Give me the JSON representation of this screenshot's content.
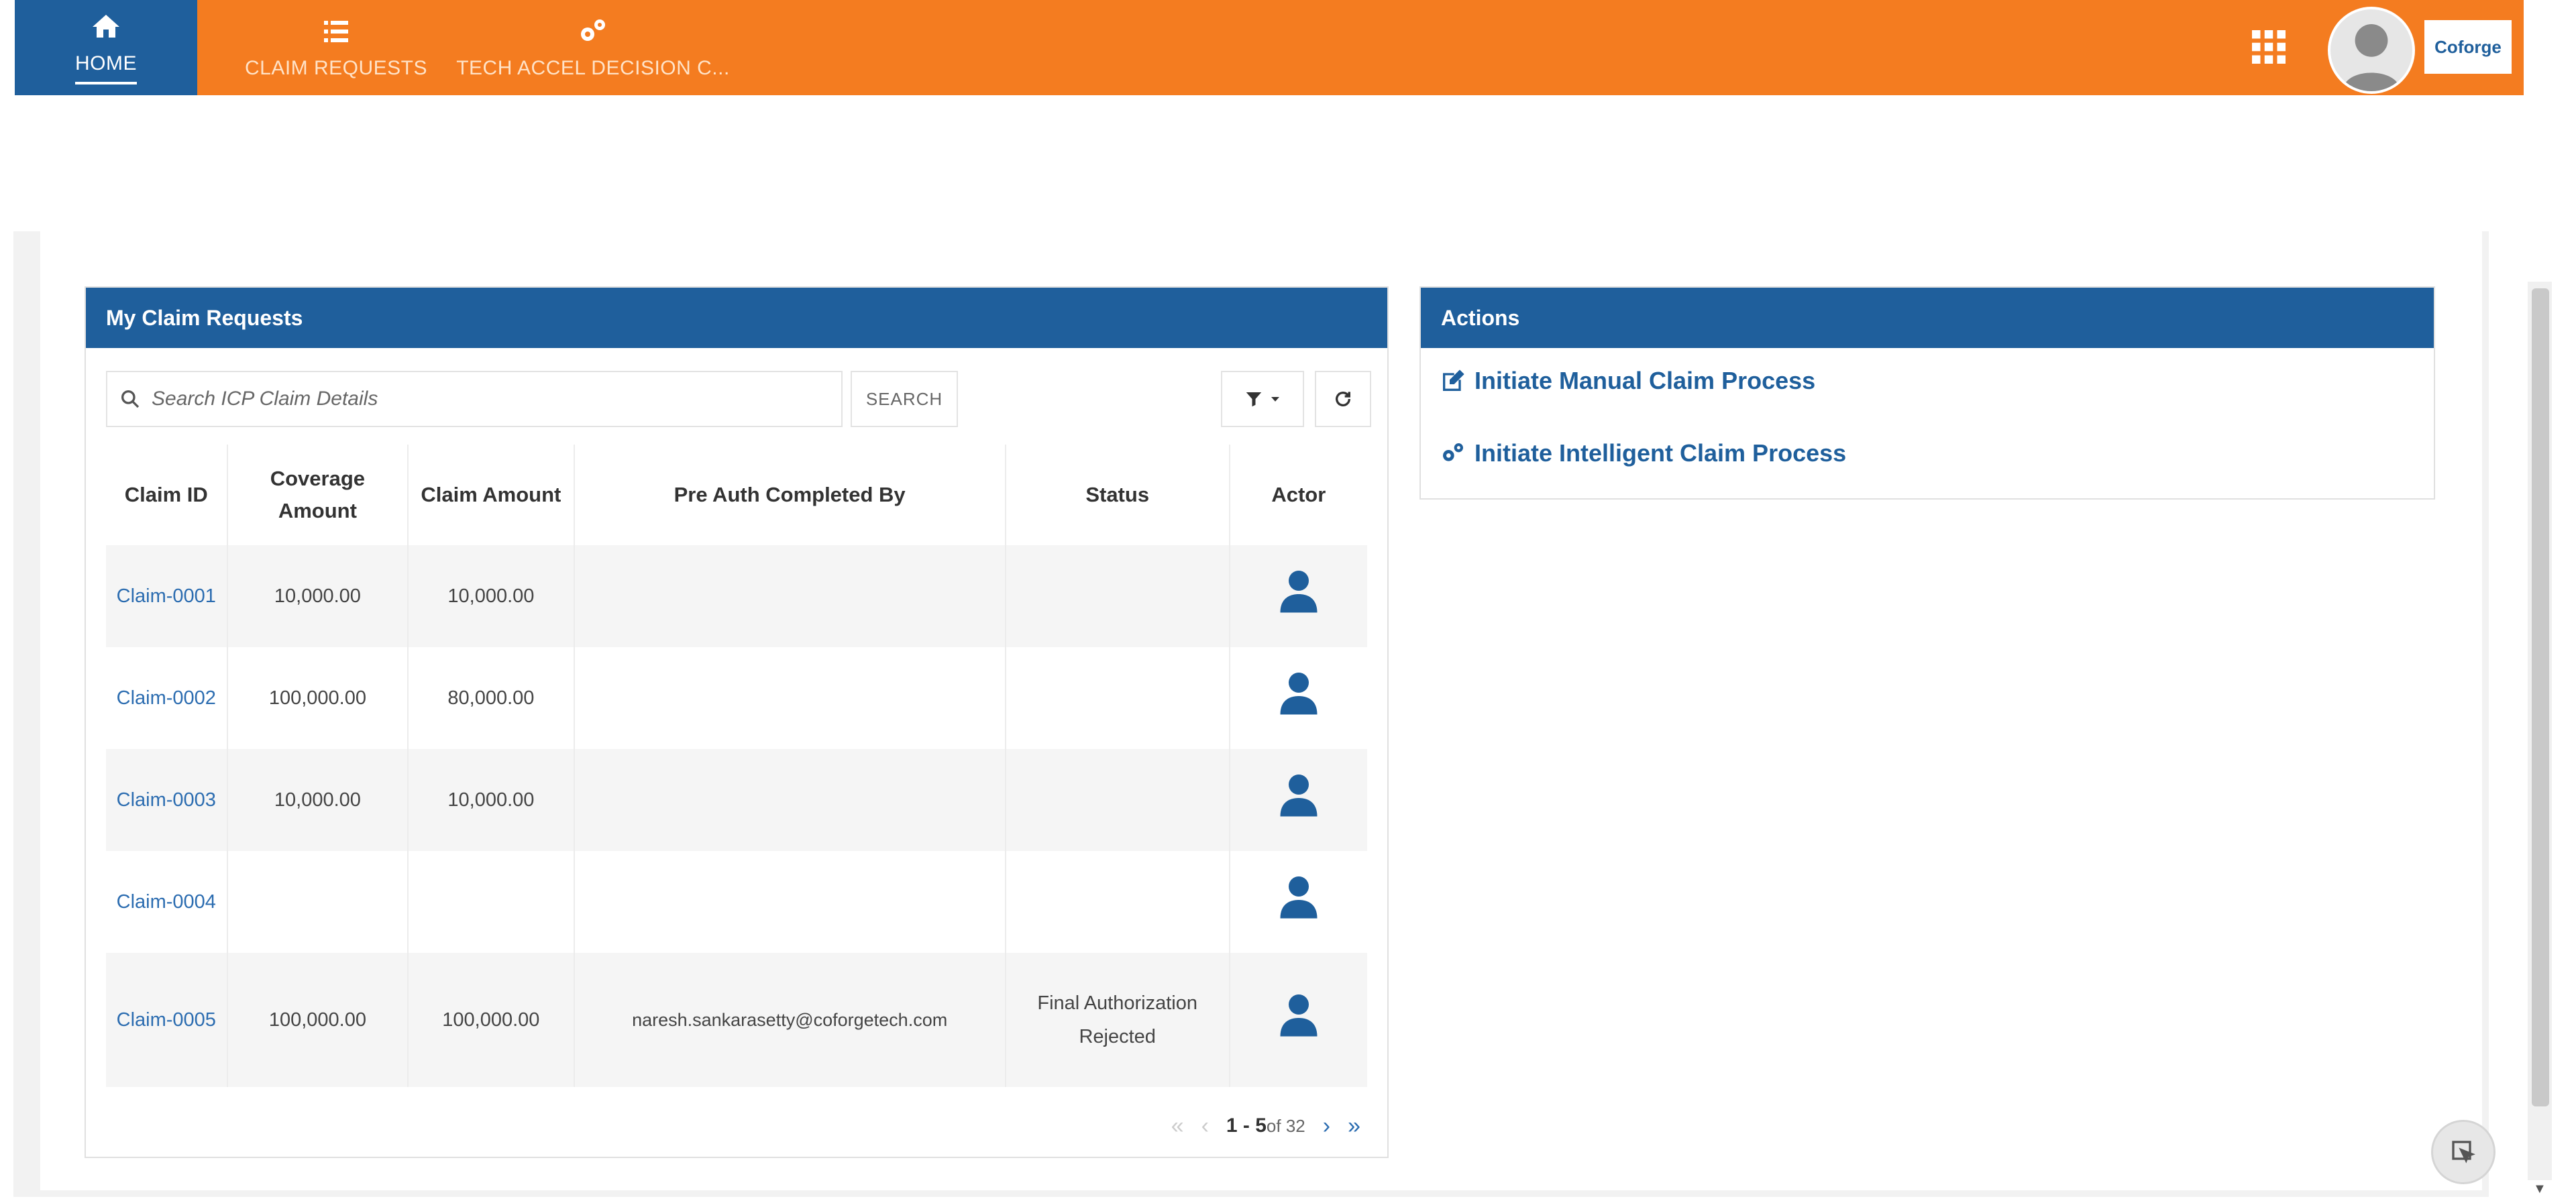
{
  "nav": {
    "home": "HOME",
    "claim_requests": "CLAIM REQUESTS",
    "tech_accel": "TECH ACCEL DECISION C..."
  },
  "brand": {
    "logo_text": "Coforge"
  },
  "icons": [
    "home-icon",
    "list-icon",
    "cogs-icon",
    "apps-grid-icon",
    "user-avatar-icon",
    "search-icon",
    "filter-icon",
    "refresh-icon",
    "person-icon",
    "edit-icon",
    "cog-icon",
    "chevron-icon"
  ],
  "colors": {
    "topbar": "#f47c20",
    "brand_blue": "#1f5f9c",
    "link": "#2b6cb0"
  },
  "claims_panel": {
    "title": "My Claim Requests",
    "search_placeholder": "Search ICP Claim Details",
    "search_button": "SEARCH",
    "columns": {
      "claim_id": "Claim ID",
      "coverage": "Coverage Amount",
      "claim_amount": "Claim Amount",
      "pre_auth": "Pre Auth Completed By",
      "status": "Status",
      "actor": "Actor"
    },
    "rows": [
      {
        "id": "Claim-0001",
        "coverage": "10,000.00",
        "amount": "10,000.00",
        "pre_auth": "",
        "status": ""
      },
      {
        "id": "Claim-0002",
        "coverage": "100,000.00",
        "amount": "80,000.00",
        "pre_auth": "",
        "status": ""
      },
      {
        "id": "Claim-0003",
        "coverage": "10,000.00",
        "amount": "10,000.00",
        "pre_auth": "",
        "status": ""
      },
      {
        "id": "Claim-0004",
        "coverage": "",
        "amount": "",
        "pre_auth": "",
        "status": ""
      },
      {
        "id": "Claim-0005",
        "coverage": "100,000.00",
        "amount": "100,000.00",
        "pre_auth": "naresh.sankarasetty@coforgetech.com",
        "status": "Final Authorization Rejected"
      }
    ],
    "pager": {
      "range": "1 - 5",
      "of": "of 32"
    }
  },
  "actions_panel": {
    "title": "Actions",
    "manual": "Initiate Manual Claim Process",
    "intelligent": "Initiate Intelligent Claim Process"
  }
}
